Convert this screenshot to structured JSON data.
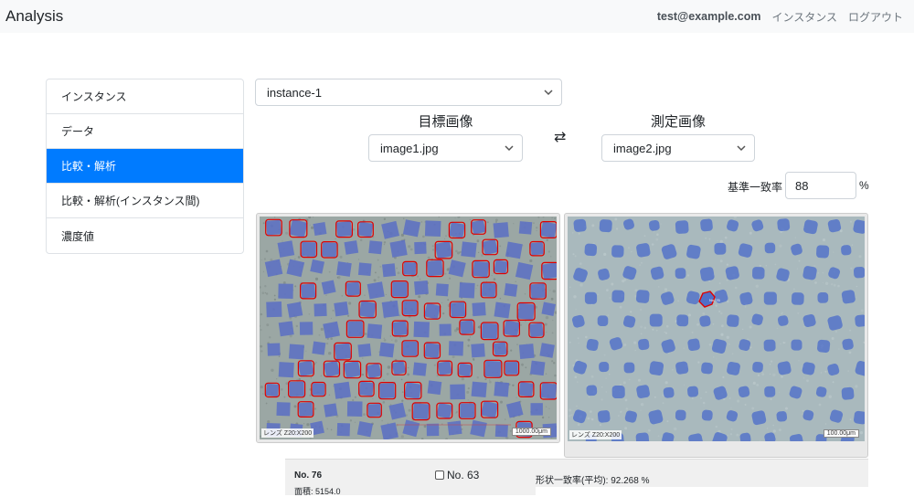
{
  "navbar": {
    "brand": "Analysis",
    "email": "test@example.com",
    "link_instances": "インスタンス",
    "link_logout": "ログアウト"
  },
  "sidebar": {
    "items": [
      {
        "label": "インスタンス"
      },
      {
        "label": "データ"
      },
      {
        "label": "比較・解析",
        "active": true
      },
      {
        "label": "比較・解析(インスタンス間)"
      },
      {
        "label": "濃度値"
      }
    ]
  },
  "instance_select": {
    "value": "instance-1"
  },
  "target_image": {
    "heading": "目標画像",
    "value": "image1.jpg"
  },
  "measure_image": {
    "heading": "測定画像",
    "value": "image2.jpg"
  },
  "swap_symbol": "⇄",
  "match_threshold": {
    "label": "基準一致率",
    "value": "88",
    "unit": "%"
  },
  "left_image": {
    "lens": "レンズ Z20:X200",
    "scale": "1000.00μm"
  },
  "right_image": {
    "lens": "レンズ Z20:X200",
    "scale": "100.00μm",
    "marker": "No. 76"
  },
  "info": {
    "number": "No. 76",
    "area": "面積: 5154.0",
    "checkbox_label": "No. 63",
    "shape_match": "形状一致率(平均): 92.268 %"
  },
  "colors": {
    "accent": "#007bff",
    "outline": "#e00000",
    "dot": "#5b6fc4"
  }
}
